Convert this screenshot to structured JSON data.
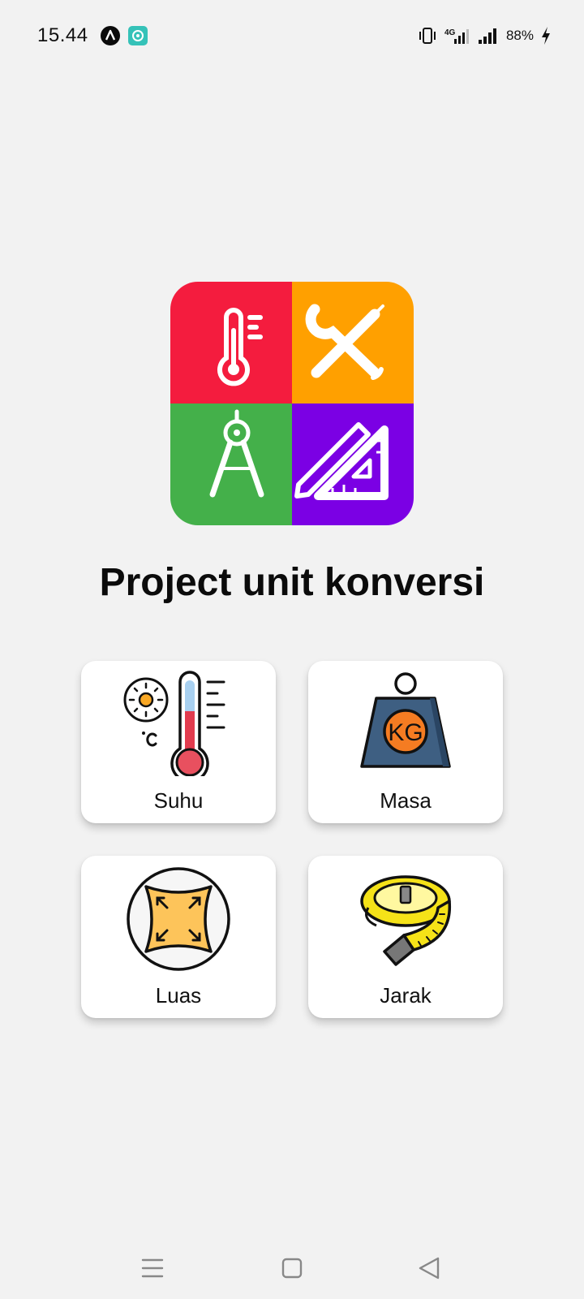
{
  "status_bar": {
    "time": "15.44",
    "network": "4G",
    "battery": "88%",
    "icons": [
      "notification-a-icon",
      "notification-b-icon",
      "vibrate-icon",
      "signal-4g-icon",
      "signal-icon",
      "charging-icon"
    ]
  },
  "app": {
    "title": "Project unit konversi",
    "logo_colors": [
      "#f41c3e",
      "#ffa000",
      "#44b04a",
      "#7b00e4"
    ]
  },
  "menu": [
    {
      "label": "Suhu",
      "icon": "thermometer-icon"
    },
    {
      "label": "Masa",
      "icon": "kg-weight-icon"
    },
    {
      "label": "Luas",
      "icon": "area-icon"
    },
    {
      "label": "Jarak",
      "icon": "measuring-tape-icon"
    }
  ],
  "nav_bar": {
    "buttons": [
      "menu-icon",
      "home-icon",
      "back-icon"
    ]
  }
}
